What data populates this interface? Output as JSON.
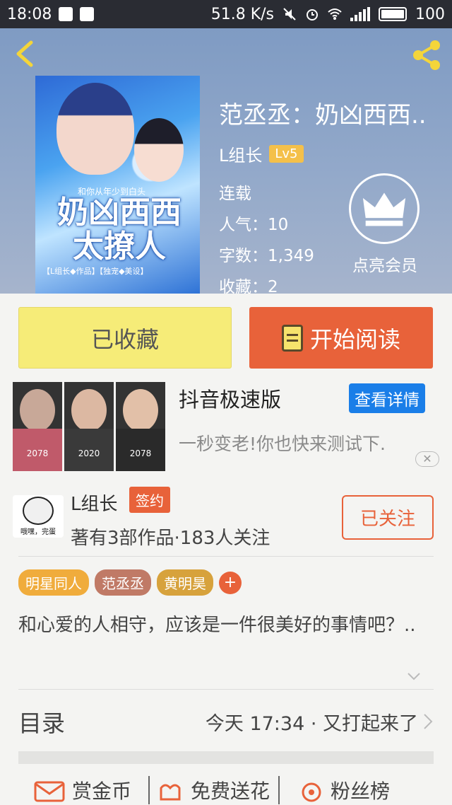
{
  "status_bar": {
    "time": "18:08",
    "speed": "51.8 K/s",
    "battery": "100"
  },
  "header": {
    "book_title": "范丞丞：奶凶西西..",
    "author": "L组长",
    "level": "Lv5",
    "status": "连载",
    "popularity": "人气：10",
    "word_count": "字数：1,349",
    "favorites": "收藏：2",
    "vip_label": "点亮会员",
    "cover_text": {
      "title_line1": "奶凶西西",
      "title_line2": "太撩人",
      "subtitle": "和你从年少到白头",
      "credits": "【L组长◆作品】【独宠◆美设】"
    }
  },
  "actions": {
    "collected_label": "已收藏",
    "read_label": "开始阅读"
  },
  "ad": {
    "title": "抖音极速版",
    "detail_button": "查看详情",
    "description": "一秒变老!你也快来测试下.",
    "thumb_years": [
      "2078",
      "2020",
      "2078"
    ]
  },
  "author_card": {
    "name": "L组长",
    "badge": "签约",
    "stats": "著有3部作品·183人关注",
    "follow_label": "已关注",
    "avatar_caption": "哦嘿，完蛋"
  },
  "tags": [
    {
      "label": "明星同人",
      "color": "#f0ac3c"
    },
    {
      "label": "范丞丞",
      "color": "#c07a66"
    },
    {
      "label": "黄明昊",
      "color": "#d7a23c"
    }
  ],
  "tag_more": "+",
  "description": "和心爱的人相守，应该是一件很美好的事情吧？..",
  "toc": {
    "label": "目录",
    "update": "今天 17:34 · 又打起来了"
  },
  "bottom_bar": {
    "reward": "赏金币",
    "flower": "免费送花",
    "fans": "粉丝榜"
  },
  "colors": {
    "accent": "#e8623a",
    "collected_bg": "#f6ec78",
    "ad_button": "#1a7ee8"
  }
}
